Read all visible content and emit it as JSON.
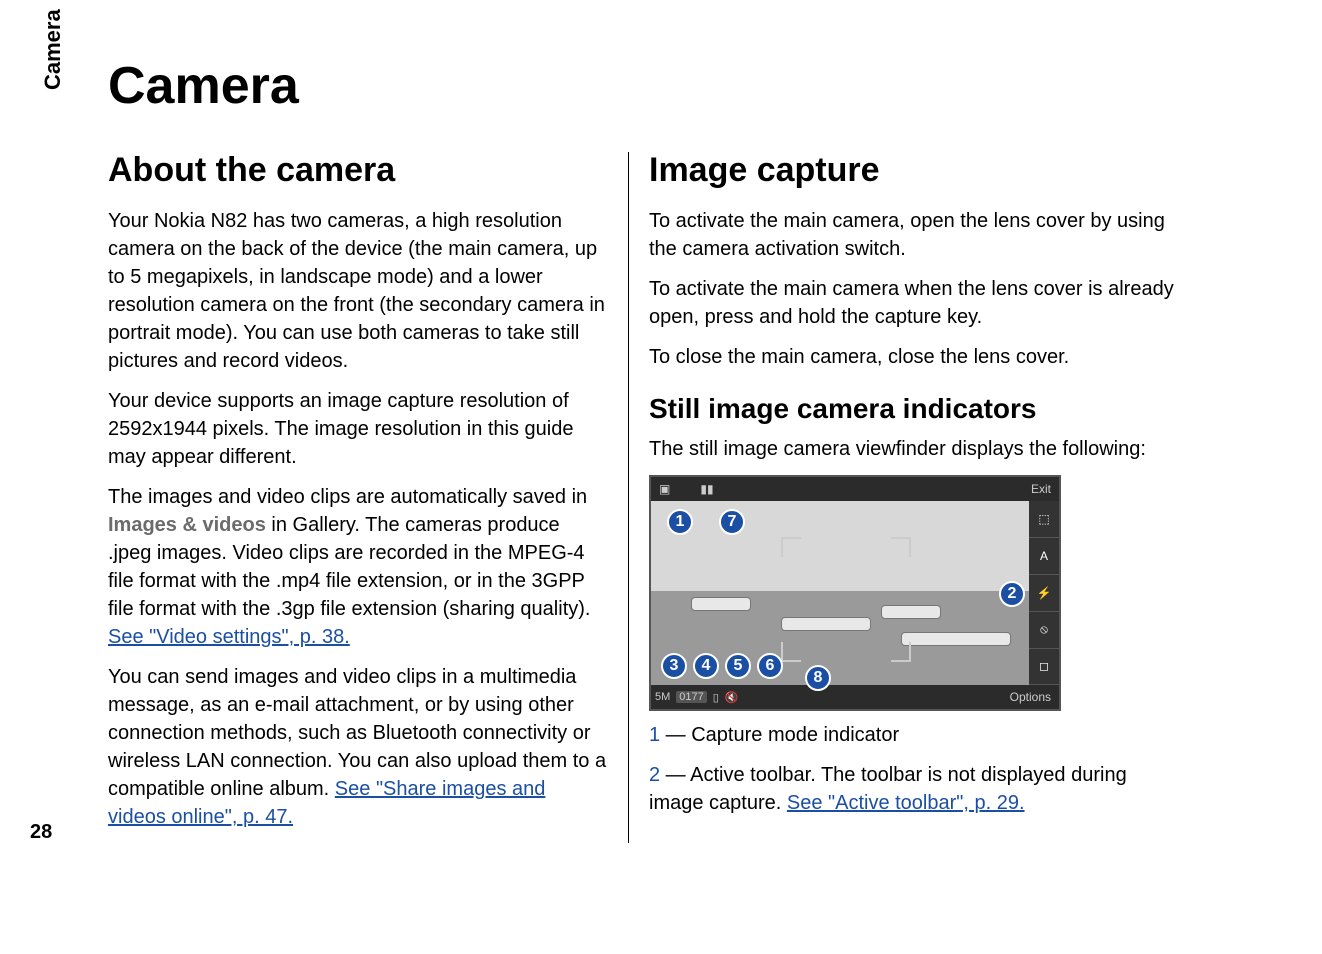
{
  "sidebar_label": "Camera",
  "page_number": "28",
  "title": "Camera",
  "left": {
    "h2": "About the camera",
    "p1": "Your Nokia N82 has two cameras, a high resolution camera on the back of the device (the main camera, up to 5 megapixels, in landscape mode) and a lower resolution camera on the front (the secondary camera in portrait mode). You can use both cameras to take still pictures and record videos.",
    "p2": "Your device supports an image capture resolution of 2592x1944 pixels. The image resolution in this guide may appear different.",
    "p3a": "The images and video clips are automatically saved in ",
    "p3_bold": "Images & videos",
    "p3b": " in Gallery. The cameras produce .jpeg images. Video clips are recorded in the MPEG-4 file format with the .mp4 file extension, or in the 3GPP file format with the .3gp file extension (sharing quality). ",
    "p3_link": "See \"Video settings\", p. 38.",
    "p4a": "You can send images and video clips in a multimedia message, as an e-mail attachment, or by using other connection methods, such as Bluetooth connectivity or wireless LAN connection. You can also upload them to a compatible online album. ",
    "p4_link": "See \"Share images and videos online\", p. 47."
  },
  "right": {
    "h2": "Image capture",
    "p1": "To activate the main camera, open the lens cover by using the camera activation switch.",
    "p2": "To activate the main camera when the lens cover is already open, press and hold the capture key.",
    "p3": "To close the main camera, close the lens cover.",
    "h3": "Still image camera indicators",
    "p4": "The still image camera viewfinder displays the following:",
    "vf": {
      "exit": "Exit",
      "options": "Options",
      "left_icon": "▣",
      "batt_icon": "▮▮",
      "side": [
        "⬚",
        "A",
        "⚡",
        "⦸",
        "◻"
      ],
      "5m": "5M",
      "counter": "0177",
      "mem": "▯",
      "snd": "🔇"
    },
    "badges": {
      "b1": "1",
      "b2": "2",
      "b3": "3",
      "b4": "4",
      "b5": "5",
      "b6": "6",
      "b7": "7",
      "b8": "8"
    },
    "list1_num": "1",
    "list1_text": " — Capture mode indicator",
    "list2_num": "2",
    "list2_text_a": " — Active toolbar. The toolbar is not displayed during image capture. ",
    "list2_link": "See \"Active toolbar\", p. 29."
  }
}
